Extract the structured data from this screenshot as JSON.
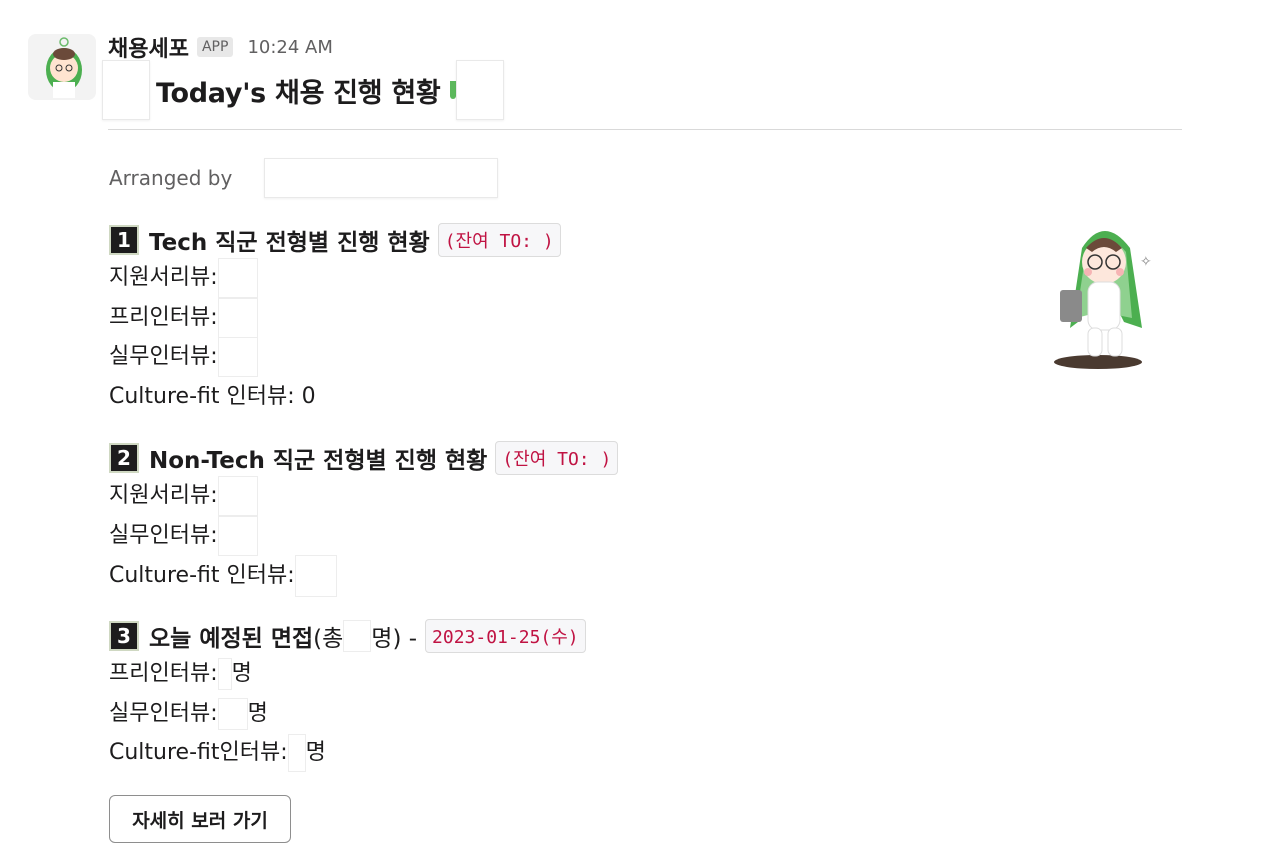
{
  "message": {
    "sender": "채용세포",
    "badge": "APP",
    "time": "10:24 AM",
    "title": "Today's 채용 진행 현황",
    "arranged_label": "Arranged by"
  },
  "sections": [
    {
      "number": "1",
      "title": "Tech 직군 전형별 진행 현황",
      "code": "(잔여 TO:  )",
      "lines": [
        {
          "label": "지원서리뷰:",
          "value": ""
        },
        {
          "label": "프리인터뷰:",
          "value": ""
        },
        {
          "label": "실무인터뷰:",
          "value": ""
        },
        {
          "label": "Culture-fit 인터뷰: 0",
          "value": ""
        }
      ]
    },
    {
      "number": "2",
      "title": "Non-Tech 직군 전형별 진행 현황",
      "code": "(잔여 TO:  )",
      "lines": [
        {
          "label": "지원서리뷰:",
          "value": ""
        },
        {
          "label": "실무인터뷰:",
          "value": ""
        },
        {
          "label": "Culture-fit 인터뷰:",
          "value": ""
        }
      ]
    },
    {
      "number": "3",
      "title": "오늘 예정된 면접",
      "title_suffix": " (총 ",
      "title_suffix2": "명) -",
      "code": "2023-01-25(수)",
      "lines": [
        {
          "label": "프리인터뷰:",
          "unit": "명"
        },
        {
          "label": "실무인터뷰:",
          "unit": "명"
        },
        {
          "label": "Culture-fit인터뷰:",
          "unit": "명"
        }
      ]
    }
  ],
  "button": {
    "label": "자세히 보러 가기"
  },
  "colors": {
    "code_text": "#c01343",
    "accent_green": "#5cb85c"
  }
}
